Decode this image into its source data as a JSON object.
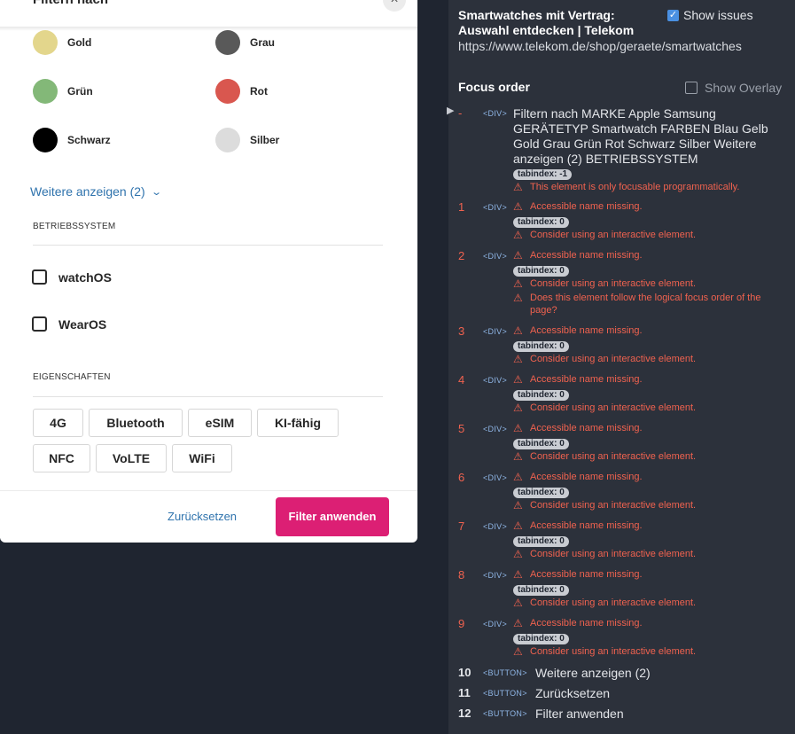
{
  "filter": {
    "title": "Filtern nach",
    "close_icon": "×",
    "colors": [
      {
        "label": "Gold",
        "color": "#e3d68c"
      },
      {
        "label": "Grau",
        "color": "#595959"
      },
      {
        "label": "Grün",
        "color": "#83b878"
      },
      {
        "label": "Rot",
        "color": "#d9574f"
      },
      {
        "label": "Schwarz",
        "color": "#000000"
      },
      {
        "label": "Silber",
        "color": "#dcdcdc"
      }
    ],
    "more_link": "Weitere anzeigen (2)",
    "os_heading": "BETRIEBSSYSTEM",
    "os_options": [
      "watchOS",
      "WearOS"
    ],
    "features_heading": "EIGENSCHAFTEN",
    "chips": [
      "4G",
      "Bluetooth",
      "eSIM",
      "KI-fähig",
      "NFC",
      "VoLTE",
      "WiFi"
    ],
    "reset": "Zurücksetzen",
    "apply": "Filter anwenden"
  },
  "a11y": {
    "page_title": "Smartwatches mit Vertrag: Auswahl entdecken | Telekom",
    "page_url": "https://www.telekom.de/shop/geraete/smartwatches",
    "show_issues": "Show issues",
    "focus_order": "Focus order",
    "show_overlay": "Show Overlay",
    "first": {
      "num": "-",
      "tag": "<DIV>",
      "text": "Filtern nach MARKE Apple Samsung GERÄTETYP Smartwatch FARBEN Blau Gelb Gold Grau Grün Rot Schwarz Silber Weitere anzeigen (2) BETRIEBSSYSTEM",
      "tabindex": "tabindex: -1",
      "issue": "This element is only focusable programmatically."
    },
    "div_entries": [
      {
        "num": "1",
        "missing": "Accessible name missing.",
        "tabindex": "tabindex: 0",
        "issue": "Consider using an interactive element."
      },
      {
        "num": "2",
        "missing": "Accessible name missing.",
        "tabindex": "tabindex: 0",
        "issue": "Consider using an interactive element.",
        "issue2": "Does this element follow the logical focus order of the page?"
      },
      {
        "num": "3",
        "missing": "Accessible name missing.",
        "tabindex": "tabindex: 0",
        "issue": "Consider using an interactive element."
      },
      {
        "num": "4",
        "missing": "Accessible name missing.",
        "tabindex": "tabindex: 0",
        "issue": "Consider using an interactive element."
      },
      {
        "num": "5",
        "missing": "Accessible name missing.",
        "tabindex": "tabindex: 0",
        "issue": "Consider using an interactive element."
      },
      {
        "num": "6",
        "missing": "Accessible name missing.",
        "tabindex": "tabindex: 0",
        "issue": "Consider using an interactive element."
      },
      {
        "num": "7",
        "missing": "Accessible name missing.",
        "tabindex": "tabindex: 0",
        "issue": "Consider using an interactive element."
      },
      {
        "num": "8",
        "missing": "Accessible name missing.",
        "tabindex": "tabindex: 0",
        "issue": "Consider using an interactive element."
      },
      {
        "num": "9",
        "missing": "Accessible name missing.",
        "tabindex": "tabindex: 0",
        "issue": "Consider using an interactive element."
      }
    ],
    "div_tag": "<DIV>",
    "button_tag": "<BUTTON>",
    "button_entries": [
      {
        "num": "10",
        "label": "Weitere anzeigen (2)"
      },
      {
        "num": "11",
        "label": "Zurücksetzen"
      },
      {
        "num": "12",
        "label": "Filter anwenden"
      }
    ],
    "warn_icon": "⚠",
    "arrow_icon": "▶",
    "check_icon": "✓"
  }
}
